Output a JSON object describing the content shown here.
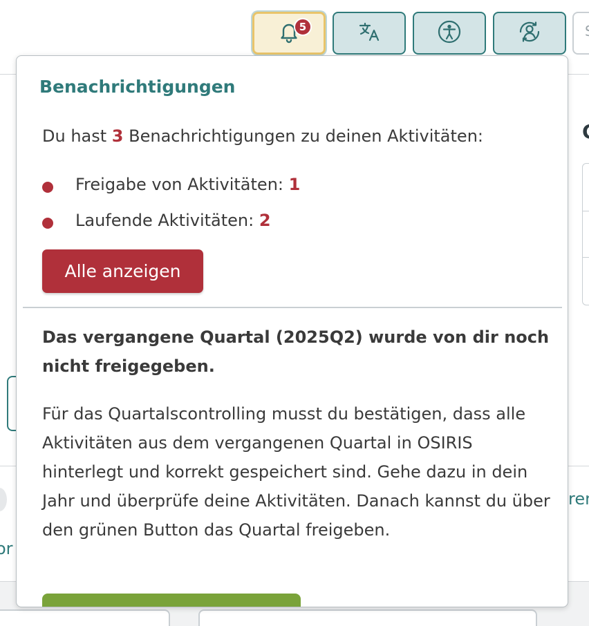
{
  "header": {
    "notification_count": "5",
    "buttons": [
      {
        "icon": "bell-icon"
      },
      {
        "icon": "translate-icon"
      },
      {
        "icon": "accessibility-icon"
      },
      {
        "icon": "user-switch-icon"
      }
    ],
    "search_fragment": "S"
  },
  "background": {
    "right_heading_fragment": "C",
    "left_text_fragment": "or",
    "right_text_fragment": "ren"
  },
  "notifications": {
    "title": "Benachrichtigungen",
    "intro_prefix": "Du hast",
    "intro_count": "3",
    "intro_suffix": "Benachrichtigungen zu deinen Aktivitäten:",
    "items": [
      {
        "label": "Freigabe von Aktivitäten:",
        "count": "1"
      },
      {
        "label": "Laufende Aktivitäten:",
        "count": "2"
      }
    ],
    "show_all_label": "Alle anzeigen",
    "quarter_warning": "Das vergangene Quartal (2025Q2) wurde von dir noch nicht freigegeben.",
    "quarter_text": "Für das Quartalscontrolling musst du bestätigen, dass alle Aktivitäten aus dem vergangenen Quartal in OSIRIS hinterlegt und korrekt gespeichert sind. Gehe dazu in dein Jahr und überprüfe deine Aktivitäten. Danach kannst du über den grünen Button das Quartal freigeben.",
    "green_button_label": ""
  },
  "colors": {
    "accent": "#2f7a7a",
    "danger": "#b0303a",
    "success": "#7aa33a",
    "highlight": "#e9c46a"
  }
}
